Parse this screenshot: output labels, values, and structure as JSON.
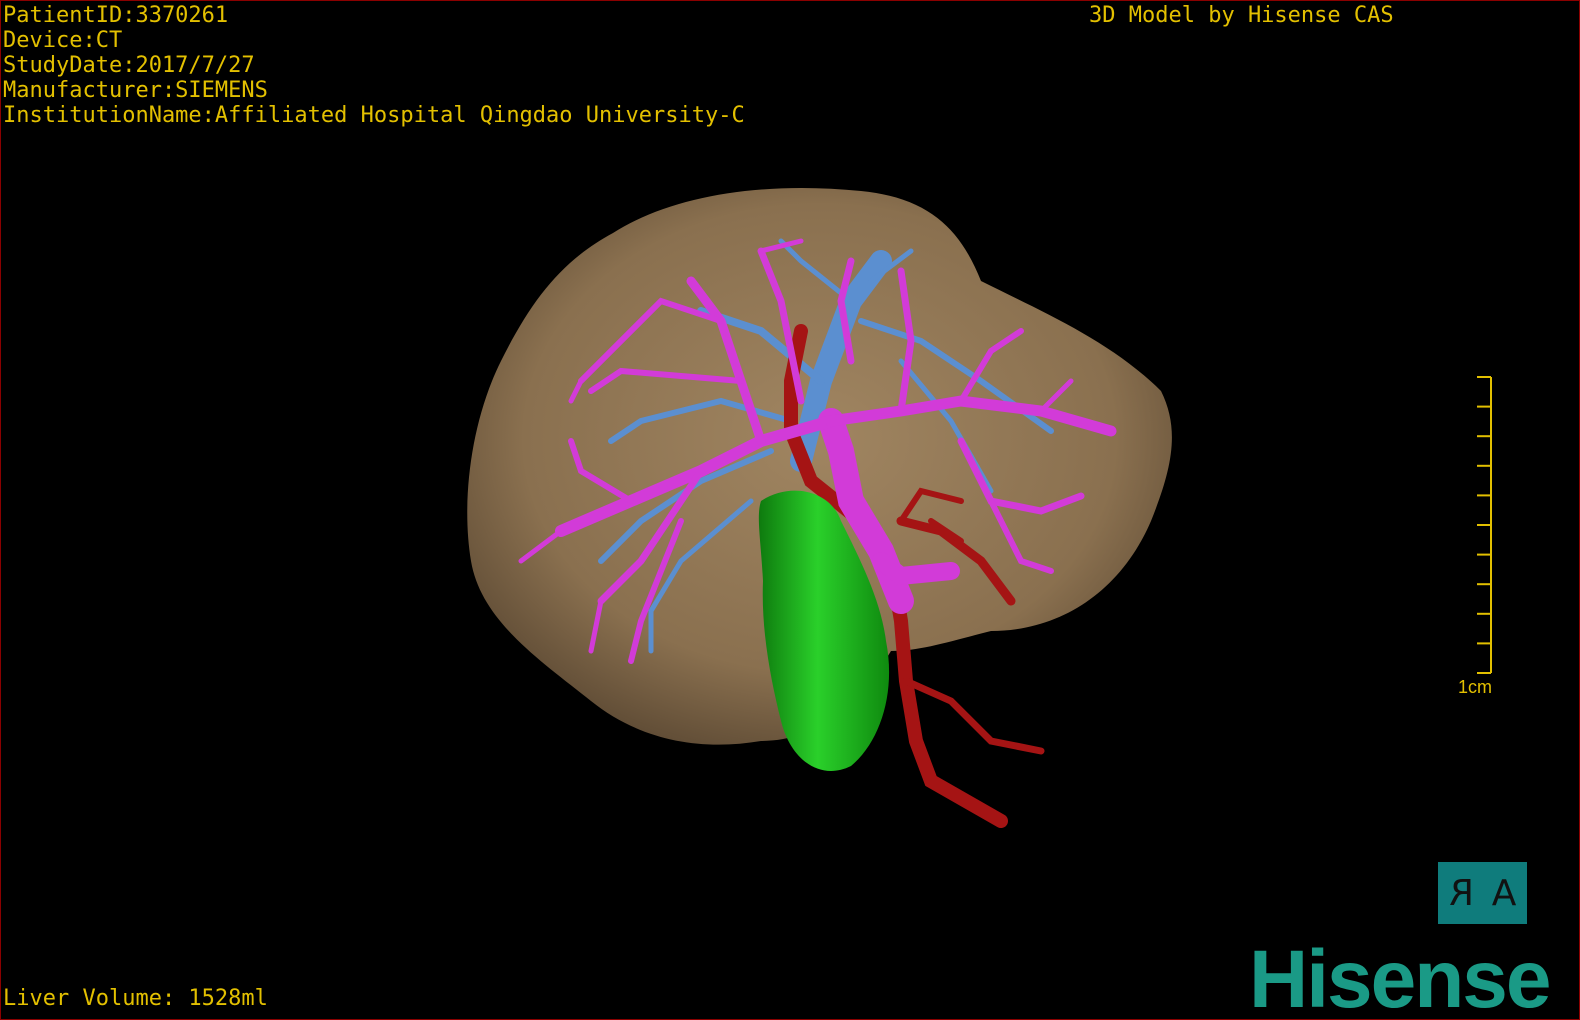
{
  "study": {
    "patient_id": "PatientID:3370261",
    "device": "Device:CT",
    "study_date": "StudyDate:2017/7/27",
    "manufacturer": "Manufacturer:SIEMENS",
    "institution": "InstitutionName:Affiliated Hospital Qingdao University-C"
  },
  "credit": "3D Model by Hisense CAS",
  "volume": "Liver Volume: 1528ml",
  "scale_bar": {
    "label": "1cm",
    "ticks": 10
  },
  "orientation": {
    "left_glyph": "R",
    "right_glyph": "A"
  },
  "brand": "Hisense",
  "colors": {
    "overlay_text": "#e3c000",
    "liver": "#8c7253",
    "portal_vein": "#d23bd8",
    "hepatic_vein": "#5b8fd0",
    "artery": "#a51414",
    "gallbladder": "#1fb81f",
    "brand": "#1a9a86",
    "border": "#8b0000"
  },
  "icons": [
    "orientation-cube-icon",
    "scale-bar-icon",
    "hisense-logo"
  ]
}
